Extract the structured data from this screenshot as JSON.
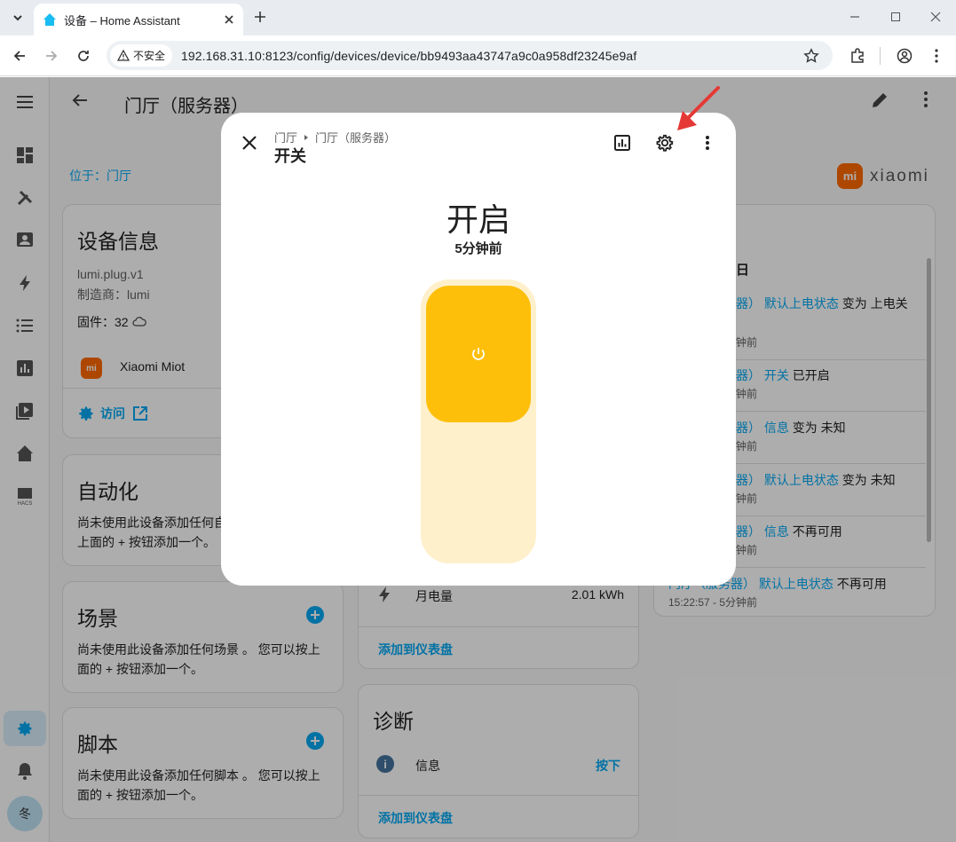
{
  "browser": {
    "tab_title": "设备 – Home Assistant",
    "security_label": "不安全",
    "url": "192.168.31.10:8123/config/devices/device/bb9493aa43747a9c0a958df23245e9af"
  },
  "page": {
    "title": "门厅（服务器）",
    "area_label": "位于：门厅",
    "brand": "xiaomi"
  },
  "device_info": {
    "title": "设备信息",
    "model": "lumi.plug.v1",
    "manufacturer": "制造商：lumi",
    "firmware": "固件：32",
    "integration": "Xiaomi Miot",
    "visit_label": "访问"
  },
  "automation": {
    "title": "自动化",
    "text1": "尚未使用此设备添加任何自",
    "text2": "上面的 + 按钮添加一个。"
  },
  "scene": {
    "title": "场景",
    "text1": "尚未使用此设备添加任何场景 。 您可以按上",
    "text2": "面的 + 按钮添加一个。"
  },
  "script": {
    "title": "脚本",
    "text1": "尚未使用此设备添加任何脚本 。 您可以按上",
    "text2": "面的 + 按钮添加一个。"
  },
  "energy": {
    "entity": "月电量",
    "value": "2.01 kWh",
    "add_to_dashboard": "添加到仪表盘"
  },
  "diagnostics": {
    "title": "诊断",
    "entity": "信息",
    "action": "按下",
    "add_to_dashboard": "添加到仪表盘"
  },
  "logbook": {
    "heading": "日",
    "entries": [
      {
        "prefix": "器）",
        "entity": "默认上电状态",
        "action": "变为 上电关",
        "time": "钟前"
      },
      {
        "prefix": "器）",
        "entity": "开关",
        "action": "已开启",
        "time": "钟前"
      },
      {
        "prefix": "器）",
        "entity": "信息",
        "action": "变为 未知",
        "time": "钟前"
      },
      {
        "prefix": "器）",
        "entity": "默认上电状态",
        "action": "变为 未知",
        "time": "钟前"
      },
      {
        "prefix": "器）",
        "entity": "信息",
        "action": "不再可用",
        "time": "钟前"
      },
      {
        "prefix": "门厅（服务器）",
        "entity": "默认上电状态",
        "action": "不再可用",
        "time": "15:22:57 - 5分钟前"
      }
    ]
  },
  "user": {
    "avatar_initial": "冬"
  },
  "dialog": {
    "breadcrumb_area": "门厅",
    "breadcrumb_device": "门厅（服务器）",
    "entity_name": "开关",
    "state": "开启",
    "last_changed": "5分钟前"
  },
  "colors": {
    "accent": "#03a9f4",
    "toggle_on": "#fdbf0a",
    "toggle_track": "#fef0cb",
    "arrow": "#e53935"
  }
}
